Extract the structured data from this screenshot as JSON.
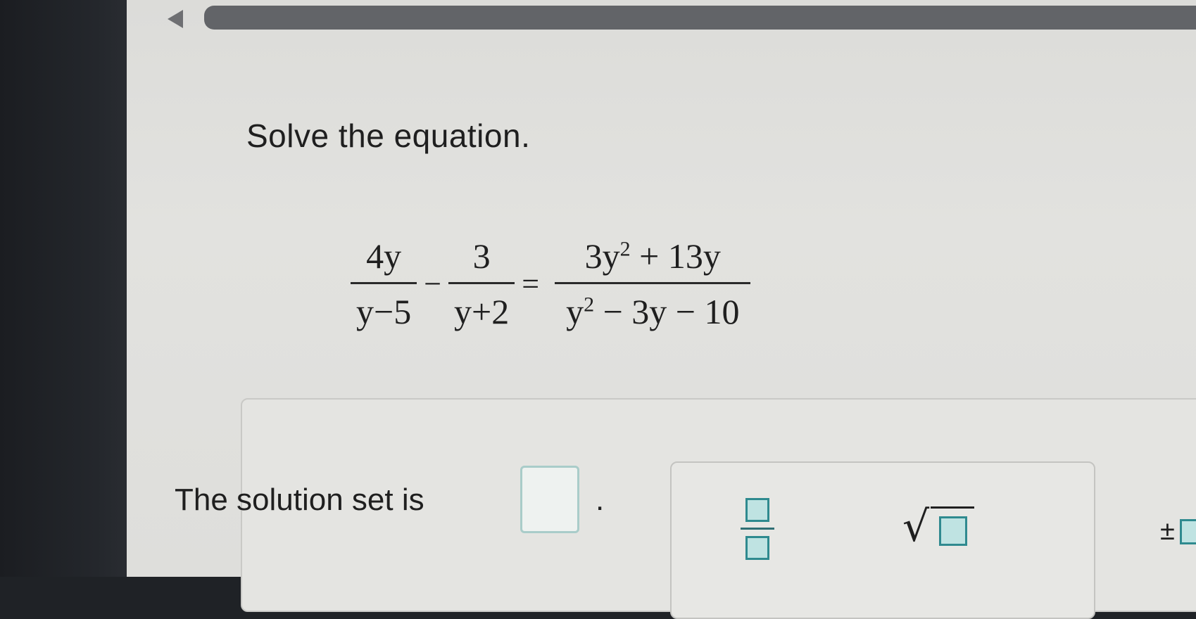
{
  "question": {
    "instruction": "Solve the equation.",
    "equation": {
      "term1": {
        "numerator": "4y",
        "denominator": "y−5"
      },
      "operator1": "−",
      "term2": {
        "numerator": "3",
        "denominator": "y+2"
      },
      "equals": "=",
      "rhs": {
        "numerator": {
          "a": "3y",
          "exp": "2",
          "b": " + 13y"
        },
        "denominator": {
          "a": "y",
          "exp": "2",
          "b": " − 3y − 10"
        }
      }
    }
  },
  "answer": {
    "prompt": "The solution set is",
    "period": ".",
    "value": ""
  },
  "toolbar": {
    "tools": [
      "fraction",
      "square-root",
      "plus-minus"
    ],
    "sqrt_symbol": "√",
    "plus_minus_symbol": "±"
  },
  "colors": {
    "accent_teal": "#2f8a8f",
    "box_fill": "#bfe3e2"
  }
}
